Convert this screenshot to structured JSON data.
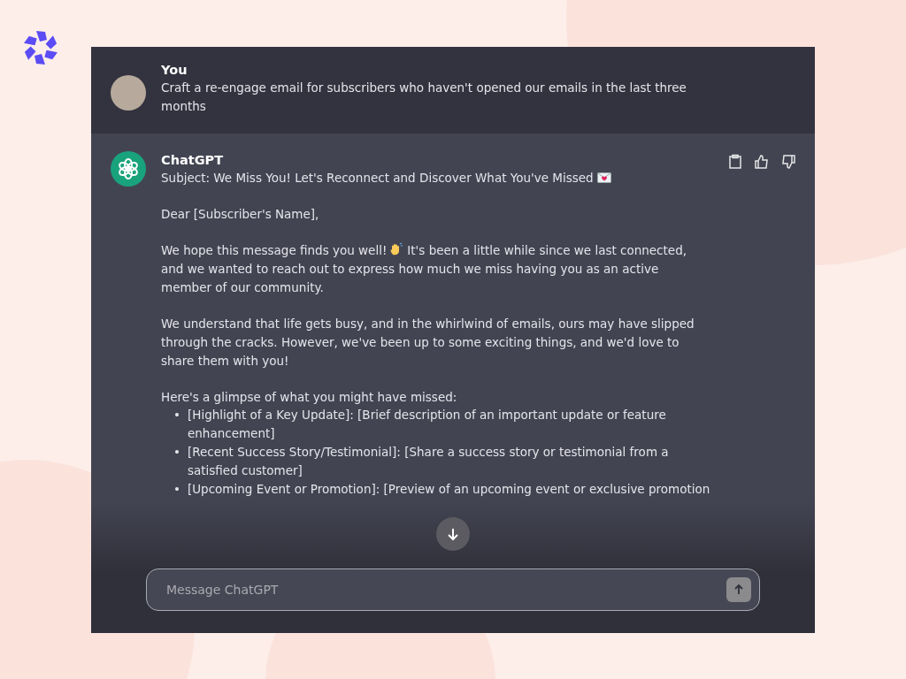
{
  "user_message": {
    "author": "You",
    "text": "Craft a re-engage email for subscribers who haven't opened our emails in the last three months"
  },
  "assistant_message": {
    "author": "ChatGPT",
    "blocks": [
      {
        "kind": "subject",
        "text": "Subject: We Miss You! Let's Reconnect and Discover What You've Missed"
      },
      {
        "kind": "paragraph",
        "text": "Dear [Subscriber's Name],"
      },
      {
        "kind": "wave_paragraph",
        "before": "We hope this message finds you well!",
        "after": "It's been a little while since we last connected, and we wanted to reach out to express how much we miss having you as an active member of our community."
      },
      {
        "kind": "paragraph",
        "text": "We understand that life gets busy, and in the whirlwind of emails, ours may have slipped through the cracks. However, we've been up to some exciting things, and we'd love to share them with you!"
      },
      {
        "kind": "paragraph",
        "text": "Here's a glimpse of what you might have missed:"
      },
      {
        "kind": "bullets",
        "marker": "•",
        "items": [
          "[Highlight of a Key Update]: [Brief description of an important update or feature enhancement]",
          "[Recent Success Story/Testimonial]: [Share a success story or testimonial from a satisfied customer]",
          "[Upcoming Event or Promotion]: [Preview of an upcoming event or exclusive promotion"
        ]
      }
    ]
  },
  "composer": {
    "placeholder": "Message ChatGPT"
  }
}
